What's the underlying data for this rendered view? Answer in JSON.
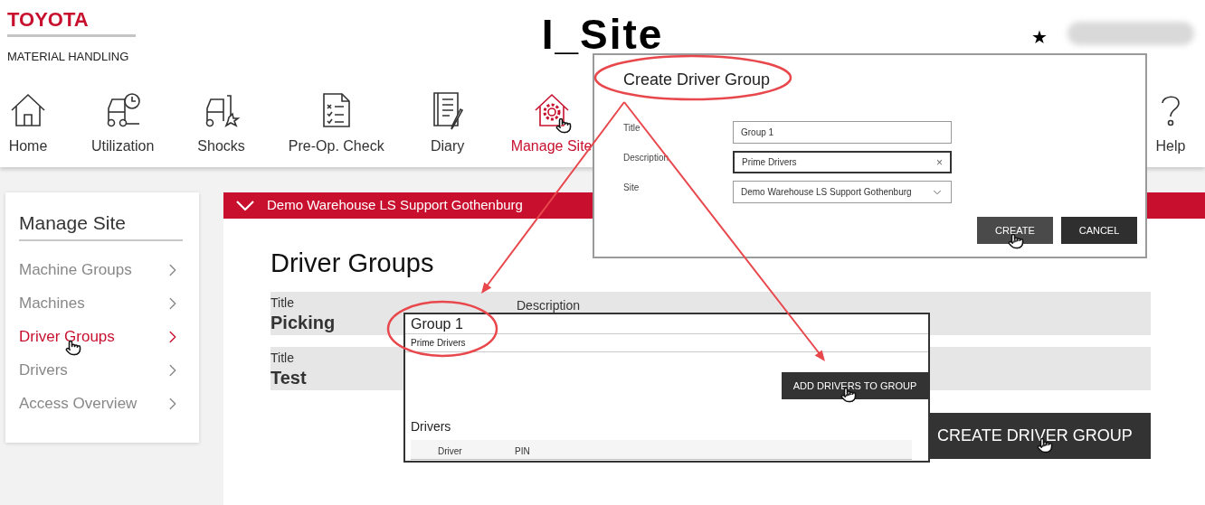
{
  "header": {
    "brand": "TOYOTA",
    "subtitle": "MATERIAL HANDLING",
    "app_title": "I_Site",
    "star": "★"
  },
  "nav": [
    {
      "label": "Home",
      "kind": "home",
      "selected": false
    },
    {
      "label": "Utilization",
      "kind": "utilization",
      "selected": false
    },
    {
      "label": "Shocks",
      "kind": "shocks",
      "selected": false
    },
    {
      "label": "Pre-Op. Check",
      "kind": "checklist",
      "selected": false
    },
    {
      "label": "Diary",
      "kind": "diary",
      "selected": false
    },
    {
      "label": "Manage Site",
      "kind": "manage",
      "selected": true
    },
    {
      "label": "Help",
      "kind": "help",
      "selected": false
    }
  ],
  "sidebar": {
    "title": "Manage Site",
    "items": [
      {
        "label": "Machine Groups",
        "selected": false
      },
      {
        "label": "Machines",
        "selected": false
      },
      {
        "label": "Driver Groups",
        "selected": true
      },
      {
        "label": "Drivers",
        "selected": false
      },
      {
        "label": "Access Overview",
        "selected": false
      }
    ]
  },
  "site_bar": {
    "title": "Demo Warehouse LS Support Gothenburg"
  },
  "page_title": "Driver Groups",
  "groups": [
    {
      "title_label": "Title",
      "title": "Picking",
      "description_label": "Description"
    },
    {
      "title_label": "Title",
      "title": "Test"
    }
  ],
  "create_group_button": "CREATE DRIVER GROUP",
  "group_panel": {
    "title": "Group 1",
    "description": "Prime Drivers",
    "add_button": "ADD DRIVERS TO GROUP",
    "drivers_heading": "Drivers",
    "columns": [
      "Driver",
      "PIN"
    ]
  },
  "dialog": {
    "title": "Create Driver Group",
    "fields": [
      {
        "label": "Title",
        "kind": "text",
        "value": "Group 1",
        "focused": false
      },
      {
        "label": "Description",
        "kind": "clearable",
        "value": "Prime Drivers",
        "clear": "×",
        "focused": true
      },
      {
        "label": "Site",
        "kind": "select",
        "value": "Demo Warehouse LS Support Gothenburg",
        "focused": false
      }
    ],
    "buttons": [
      {
        "label": "CREATE",
        "hovered": true
      },
      {
        "label": "CANCEL",
        "hovered": false
      }
    ]
  }
}
